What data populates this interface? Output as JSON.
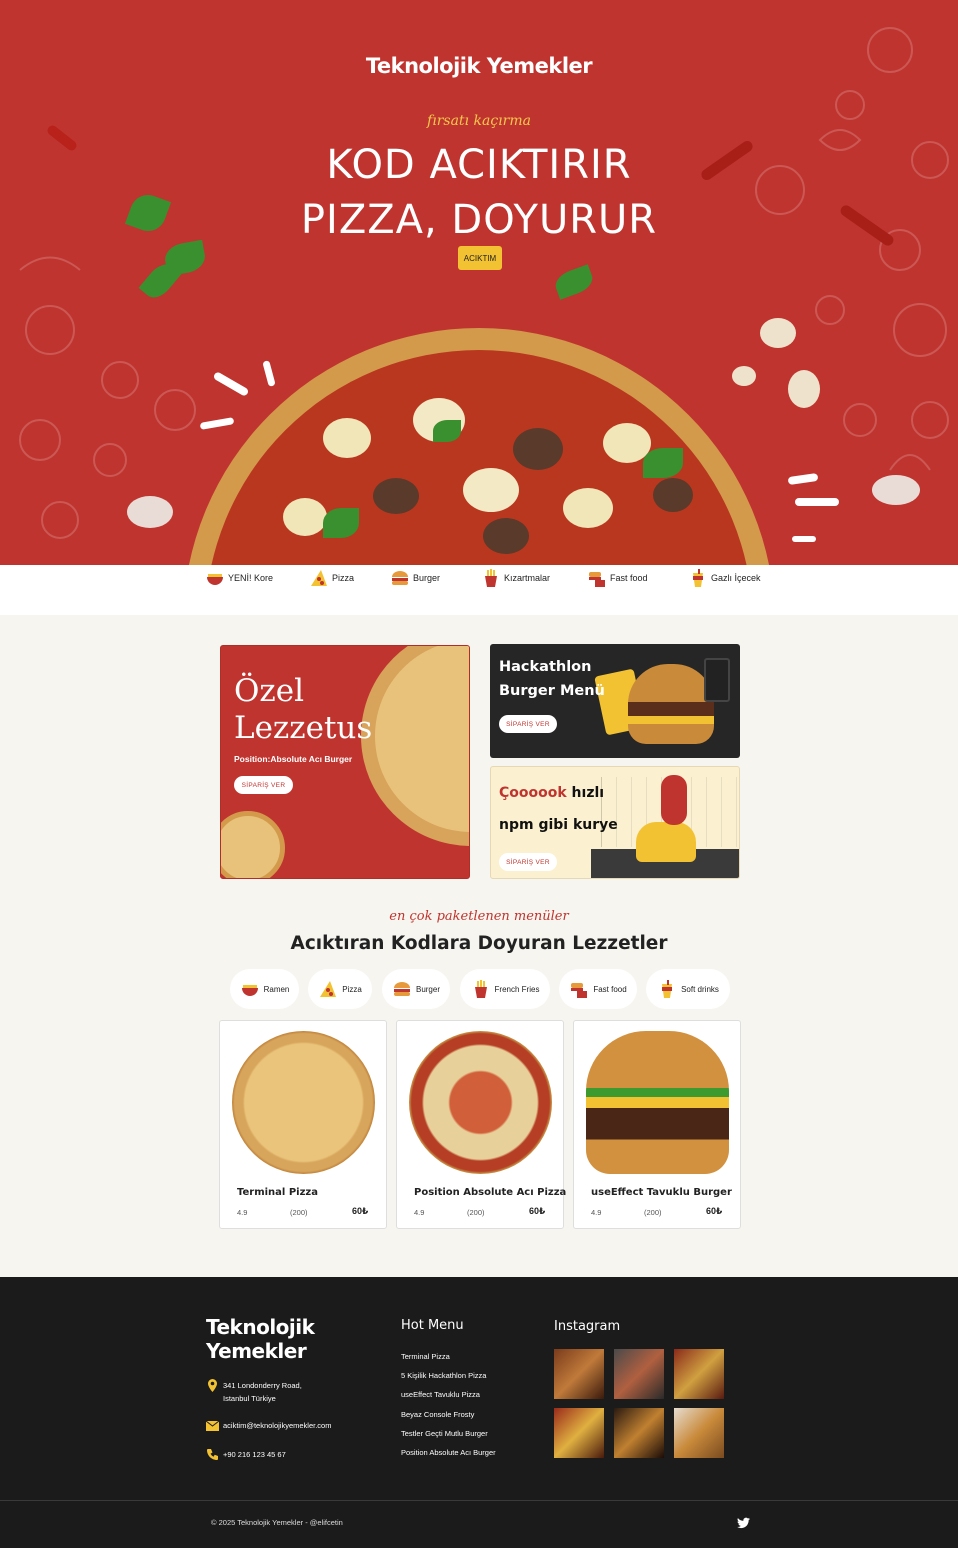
{
  "hero": {
    "brand": "Teknolojik Yemekler",
    "tagline": "fırsatı kaçırma",
    "headline_line1": "KOD ACIKTIRIR",
    "headline_line2": "PIZZA, DOYURUR",
    "cta_label": "ACIKTIM"
  },
  "categories": [
    {
      "label": "YENİ! Kore",
      "icon": "ramen-icon"
    },
    {
      "label": "Pizza",
      "icon": "pizza-icon"
    },
    {
      "label": "Burger",
      "icon": "burger-icon"
    },
    {
      "label": "Kızartmalar",
      "icon": "fries-icon"
    },
    {
      "label": "Fast food",
      "icon": "fastfood-icon"
    },
    {
      "label": "Gazlı İçecek",
      "icon": "drink-icon"
    }
  ],
  "promos": {
    "ozel": {
      "title": "Özel Lezzetus",
      "subtitle": "Position:Absolute Acı Burger",
      "button": "SİPARİŞ VER"
    },
    "hackathlon": {
      "title": "Hackathlon Burger Menü",
      "button": "SİPARİŞ VER"
    },
    "kurye": {
      "title_red": "Çoooook",
      "title_rest": " hızlı",
      "title_line2": "npm gibi kurye",
      "button": "SİPARİŞ VER"
    }
  },
  "section": {
    "tag": "en çok paketlenen menüler",
    "title": "Acıktıran Kodlara Doyuran Lezzetler"
  },
  "chips": [
    {
      "label": "Ramen",
      "icon": "ramen-icon"
    },
    {
      "label": "Pizza",
      "icon": "pizza-icon"
    },
    {
      "label": "Burger",
      "icon": "burger-icon"
    },
    {
      "label": "French Fries",
      "icon": "fries-icon"
    },
    {
      "label": "Fast food",
      "icon": "fastfood-icon"
    },
    {
      "label": "Soft drinks",
      "icon": "drink-icon"
    }
  ],
  "products": [
    {
      "name": "Terminal Pizza",
      "rating": "4.9",
      "count": "(200)",
      "price": "60₺"
    },
    {
      "name": "Position Absolute Acı Pizza",
      "rating": "4.9",
      "count": "(200)",
      "price": "60₺"
    },
    {
      "name": "useEffect Tavuklu Burger",
      "rating": "4.9",
      "count": "(200)",
      "price": "60₺"
    }
  ],
  "footer": {
    "brand": "Teknolojik Yemekler",
    "address": "341 Londonderry Road, Istanbul Türkiye",
    "email": "aciktim@teknolojikyemekler.com",
    "phone": "+90 216 123 45 67",
    "hot_menu_title": "Hot Menu",
    "hot_menu": [
      "Terminal Pizza",
      "5 Kişilik Hackathlon Pizza",
      "useEffect Tavuklu Pizza",
      "Beyaz Console Frosty",
      "Testler Geçti Mutlu Burger",
      "Position Absolute Acı Burger"
    ],
    "instagram_title": "Instagram",
    "copyright": "© 2025 Teknolojik Yemekler - @elifcetin"
  },
  "colors": {
    "brand_red": "#c0342f",
    "accent_yellow": "#f2c232",
    "footer_dark": "#1b1b1b",
    "cream": "#f7f5ef"
  }
}
